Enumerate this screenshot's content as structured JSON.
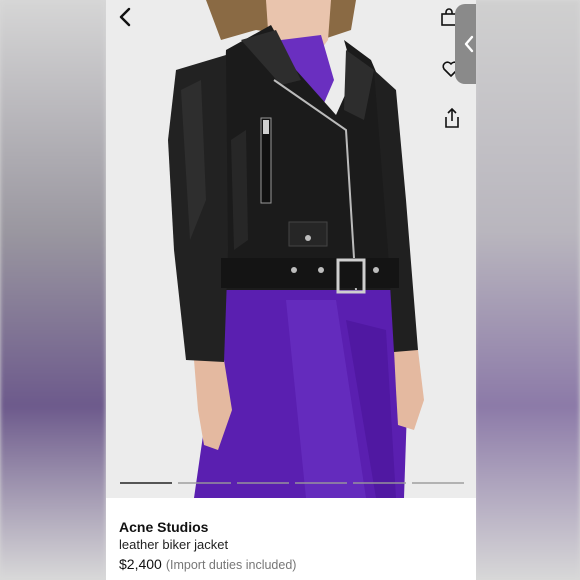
{
  "product": {
    "brand": "Acne Studios",
    "name": "leather biker jacket",
    "price": "$2,400",
    "price_note": "(Import duties included)"
  },
  "icons": {
    "back": "chevron-left-icon",
    "bag": "shopping-bag-icon",
    "wishlist": "heart-icon",
    "share": "share-icon",
    "side_tab": "chevron-left-icon"
  },
  "carousel": {
    "slide_count": 6,
    "active_index": 0
  },
  "colors": {
    "jacket": "#1b1b1b",
    "dress": "#5a1fb0",
    "background": "#ededed",
    "tab": "#8a8a8a"
  }
}
